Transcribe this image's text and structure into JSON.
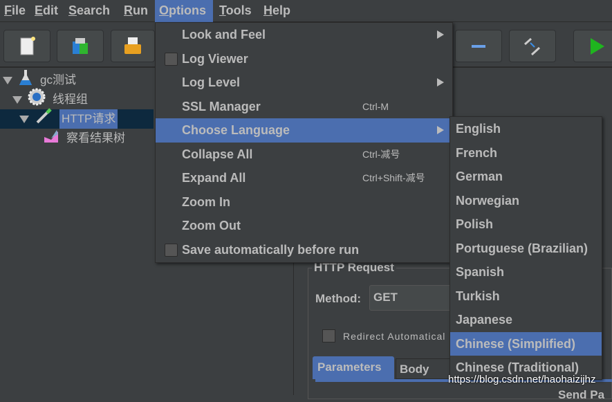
{
  "menubar": [
    {
      "label": "File",
      "u": "F"
    },
    {
      "label": "Edit",
      "u": "E"
    },
    {
      "label": "Search",
      "u": "S"
    },
    {
      "label": "Run",
      "u": "R"
    },
    {
      "label": "Options",
      "u": "O"
    },
    {
      "label": "Tools",
      "u": "T"
    },
    {
      "label": "Help",
      "u": "H"
    }
  ],
  "active_menu": "Options",
  "tree": [
    {
      "label": "gc测试",
      "icon": "flask-icon"
    },
    {
      "label": "线程组",
      "icon": "gear-icon"
    },
    {
      "label": "HTTP请求",
      "icon": "pipette-icon",
      "selected": true
    },
    {
      "label": "察看结果树",
      "icon": "chart-icon"
    }
  ],
  "options_menu": [
    {
      "label": "Look and Feel",
      "submenu": true
    },
    {
      "label": "Log Viewer",
      "checkbox": true,
      "checked": false
    },
    {
      "label": "Log Level",
      "submenu": true
    },
    {
      "label": "SSL Manager",
      "shortcut": "Ctrl-M"
    },
    {
      "label": "Choose Language",
      "submenu": true,
      "highlighted": true
    },
    {
      "label": "Collapse All",
      "shortcut": "Ctrl-减号"
    },
    {
      "label": "Expand All",
      "shortcut": "Ctrl+Shift-减号"
    },
    {
      "label": "Zoom In"
    },
    {
      "label": "Zoom Out"
    },
    {
      "label": "Save automatically before run",
      "checkbox": true,
      "checked": false
    }
  ],
  "languages": [
    "English",
    "French",
    "German",
    "Norwegian",
    "Polish",
    "Portuguese (Brazilian)",
    "Spanish",
    "Turkish",
    "Japanese",
    "Chinese (Simplified)",
    "Chinese (Traditional)"
  ],
  "selected_language": "Chinese (Simplified)",
  "http_request": {
    "title": "HTTP Request",
    "method_label": "Method:",
    "method_value": "GET",
    "redirect_label": "Redirect Automatical",
    "tabs": [
      "Parameters",
      "Body Da"
    ],
    "send_label": "Send Pa"
  },
  "watermark": "https://blog.csdn.net/haohaizijhz",
  "colors": {
    "background": "#3c3f41",
    "highlight": "#4b6eaf",
    "text": "#bbbbbb"
  }
}
